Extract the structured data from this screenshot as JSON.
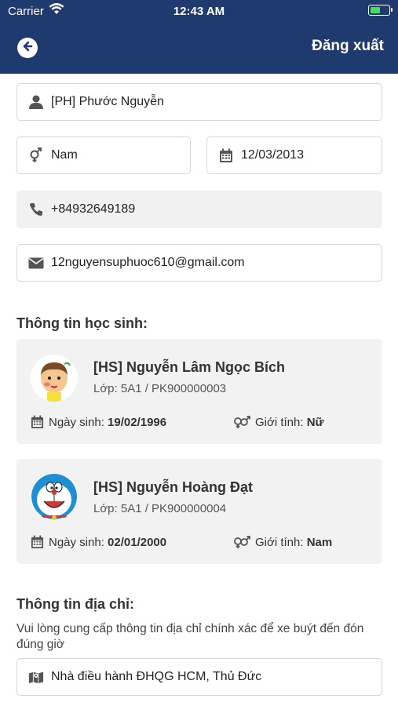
{
  "status_bar": {
    "carrier": "Carrier",
    "time": "12:43 AM"
  },
  "nav": {
    "logout_label": "Đăng xuất"
  },
  "parent": {
    "name": "[PH] Phước Nguyễn",
    "gender": "Nam",
    "birthday": "12/03/2013",
    "phone": "+84932649189",
    "email": "12nguyensuphuoc610@gmail.com"
  },
  "students_section": {
    "title": "Thông tin học sinh:",
    "birthday_label": "Ngày sinh:",
    "gender_label": "Giới tính:",
    "students": [
      {
        "name": "[HS] Nguyễn Lâm Ngọc Bích",
        "class": "Lớp: 5A1 / PK900000003",
        "birthday": "19/02/1996",
        "gender": "Nữ",
        "avatar_icon": "cartoon-boy-avatar"
      },
      {
        "name": "[HS] Nguyễn Hoàng Đạt",
        "class": "Lớp: 5A1 / PK900000004",
        "birthday": "02/01/2000",
        "gender": "Nam",
        "avatar_icon": "doraemon-avatar"
      }
    ]
  },
  "address_section": {
    "title": "Thông tin địa chỉ:",
    "description": "Vui lòng cung cấp thông tin địa chỉ chính xác để xe buýt đến đón đúng giờ",
    "address": "Nhà điều hành ĐHQG HCM, Thủ Đức"
  },
  "colors": {
    "header": "#1f3a6e",
    "field_border": "#d6d6d6",
    "readonly_bg": "#f1f1f1",
    "card_bg": "#f2f2f2",
    "icon": "#555555"
  }
}
